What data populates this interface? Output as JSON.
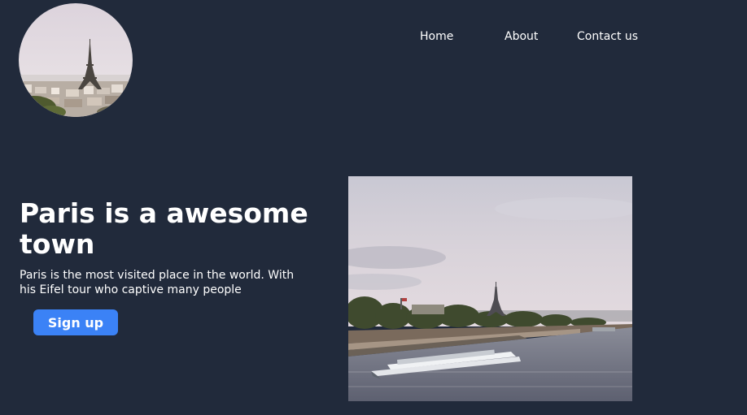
{
  "nav": {
    "items": [
      {
        "label": "Home"
      },
      {
        "label": "About"
      },
      {
        "label": "Contact us"
      }
    ]
  },
  "hero": {
    "title": "Paris is a awesome town",
    "description": "Paris is the most visited place in the world. With his Eifel tour who captive many people",
    "signup_label": "Sign up"
  },
  "images": {
    "logo": "eiffel-tower-city-photo",
    "hero": "seine-river-boat-eiffel-tower-photo"
  },
  "colors": {
    "background": "#212a3b",
    "accent": "#3b82f6",
    "text": "#ffffff"
  }
}
